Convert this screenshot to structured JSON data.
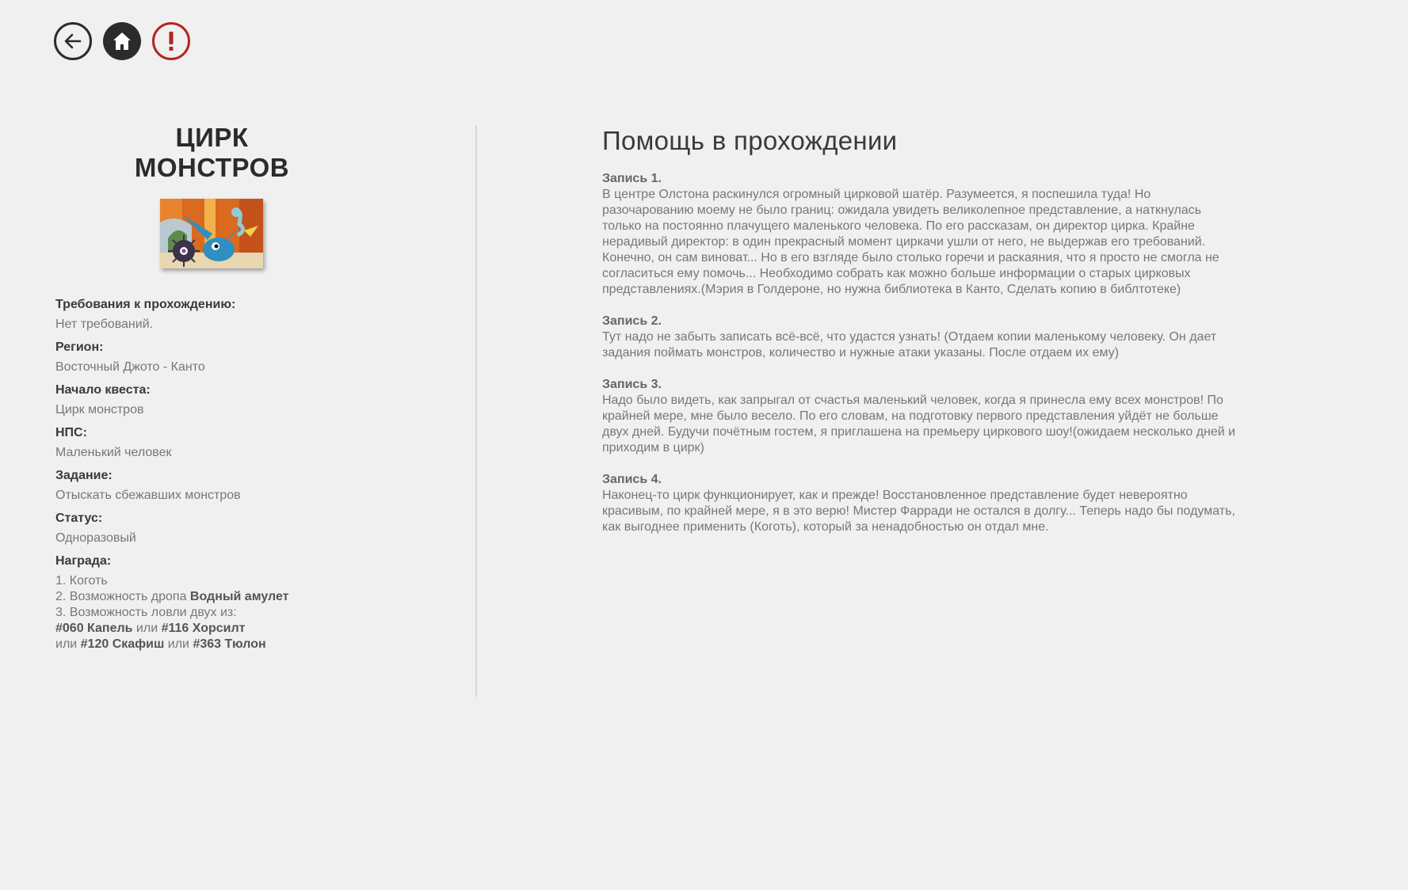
{
  "nav": {
    "back_icon": "arrow-left-icon",
    "home_icon": "home-icon",
    "alert_icon": "exclamation-icon",
    "alert_color": "#b3261e"
  },
  "quest": {
    "title_line1": "ЦИРК",
    "title_line2": "МОНСТРОВ",
    "requirements_label": "Требования к прохождению:",
    "requirements_value": "Нет требований.",
    "region_label": "Регион:",
    "region_value": "Восточный Джото - Канто",
    "start_label": "Начало квеста:",
    "start_value": "Цирк монстров",
    "npc_label": "НПС:",
    "npc_value": "Маленький человек",
    "task_label": "Задание:",
    "task_value": "Отыскать сбежавших монстров",
    "status_label": "Статус:",
    "status_value": "Одноразовый",
    "reward_label": "Награда:",
    "rewards": {
      "r1": "1.  Коготь",
      "r2_prefix": "2. Возможность дропа ",
      "r2_item": "Водный амулет",
      "r3": "3. Возможность ловли двух из:",
      "m1": "#060 Капель",
      "or1": " или ",
      "m2": "#116 Хорсилт",
      "or2": "или ",
      "m3": "#120 Скафиш",
      "or3": " или ",
      "m4": "#363 Тюлон"
    }
  },
  "help": {
    "title": "Помощь в прохождении",
    "entries": [
      {
        "title": "Запись 1.",
        "text": "В центре Олстона раскинулся огромный цирковой шатёр. Разумеется, я поспешила туда! Но разочарованию моему не было границ: ожидала увидеть великолепное представление, а наткнулась только на постоянно плачущего маленького человека. По его рассказам, он директор цирка. Крайне нерадивый директор: в один прекрасный момент циркачи ушли от него, не выдержав его требований. Конечно, он сам виноват... Но в его взгляде было столько горечи и раскаяния, что я просто не смогла не согласиться ему помочь... Необходимо собрать как можно больше информации о старых цирковых представлениях.(Мэрия в Голдероне, но нужна библиотека в Канто, Сделать копию в библтотеке)"
      },
      {
        "title": "Запись 2.",
        "text": "Тут надо не забыть записать всё-всё, что удастся узнать! (Отдаем копии маленькому человеку. Он дает задания поймать монстров, количество и нужные атаки указаны. После отдаем их ему)"
      },
      {
        "title": "Запись 3.",
        "text": "Надо было видеть, как запрыгал от счастья маленький человек, когда я принесла ему всех монстров! По крайней мере, мне было весело. По его словам, на подготовку первого представления уйдёт не больше двух дней. Будучи почётным гостем, я приглашена на премьеру циркового шоу!(ожидаем несколько дней и приходим в цирк)"
      },
      {
        "title": "Запись 4.",
        "text": "Наконец-то цирк функционирует, как и прежде! Восстановленное представление будет невероятно красивым, по крайней мере, я в это верю! Мистер Фарради не остался в долгу... Теперь надо бы подумать, как выгоднее применить (Коготь), который за ненадобностью он отдал мне."
      }
    ]
  }
}
